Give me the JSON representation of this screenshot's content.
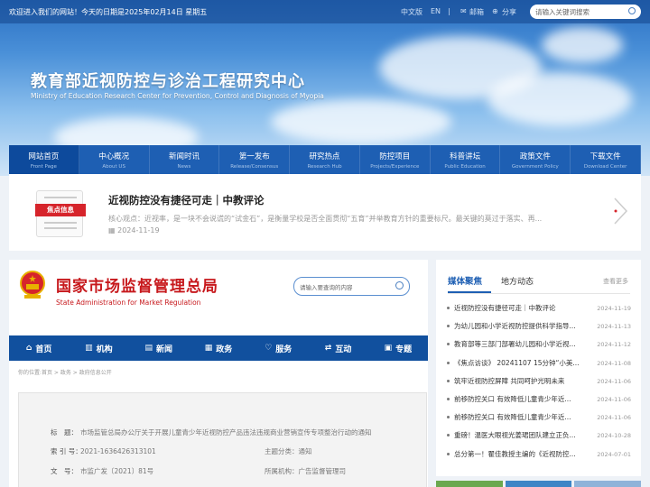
{
  "topbar": {
    "welcome": "欢迎进入我们的网站！今天的日期是2025年02月14日 星期五",
    "lang_cn": "中文版",
    "lang_en": "EN",
    "sep": "|",
    "mail": "邮箱",
    "share": "分享",
    "search_placeholder": "请输入关键词搜索"
  },
  "site": {
    "title": "教育部近视防控与诊治工程研究中心",
    "subtitle": "Ministry of Education Research Center for Prevention, Control and Diagnosis of Myopia"
  },
  "nav": [
    {
      "cn": "网站首页",
      "en": "Front Page"
    },
    {
      "cn": "中心概况",
      "en": "About US"
    },
    {
      "cn": "新闻时讯",
      "en": "News"
    },
    {
      "cn": "第一发布",
      "en": "Release/Consensus"
    },
    {
      "cn": "研究热点",
      "en": "Research Hub"
    },
    {
      "cn": "防控项目",
      "en": "Projects/Experience"
    },
    {
      "cn": "科普讲坛",
      "en": "Public Education"
    },
    {
      "cn": "政策文件",
      "en": "Government Policy"
    },
    {
      "cn": "下载文件",
      "en": "Download Center"
    }
  ],
  "focus": {
    "tag": "焦点信息",
    "headline": "近视防控没有捷径可走｜中教评论",
    "excerpt": "核心观点：近视率，是一块不会说谎的“试金石”，是衡量学校是否全面贯彻“五育”并举教育方针的重要标尺。最关键的莫过于落实、再...",
    "date": "2024-11-19"
  },
  "samr": {
    "name_cn": "国家市场监督管理总局",
    "name_en": "State Administration for Market Regulation",
    "search_placeholder": "请输入要查询的内容",
    "nav": [
      "首页",
      "机构",
      "新闻",
      "政务",
      "服务",
      "互动",
      "专题"
    ],
    "nav_icons": [
      "home-icon",
      "building-icon",
      "news-icon",
      "government-icon",
      "heart-icon",
      "exchange-icon",
      "topic-icon"
    ],
    "breadcrumb": "你的位置:首页 > 政务 > 政府信息公开",
    "doc": {
      "title_label": "标　题：",
      "title_value": "市场监管总局办公厅关于开展儿童青少年近视防控产品违法违规商业营销宣传专项整治行动的通知",
      "index_label": "索 引 号：",
      "index_value": "2021-1636426313101",
      "category_label": "主题分类：",
      "category_value": "通知",
      "number_label": "文　号：",
      "number_value": "市监广发〔2021〕81号",
      "org_label": "所属机构：",
      "org_value": "广告监督管理司"
    }
  },
  "media": {
    "tab_active": "媒体聚焦",
    "tab_other": "地方动态",
    "more": "查看更多",
    "items": [
      {
        "title": "近视防控没有捷径可走｜中教评论",
        "date": "2024-11-19"
      },
      {
        "title": "为幼儿园和小学近视防控提供科学指导...",
        "date": "2024-11-13"
      },
      {
        "title": "教育部等三部门部署幼儿园和小学近视...",
        "date": "2024-11-12"
      },
      {
        "title": "《焦点访谈》 20241107 15分钟“小美...",
        "date": "2024-11-08"
      },
      {
        "title": "筑牢近视防控屏障 共同呵护光明未来",
        "date": "2024-11-06"
      },
      {
        "title": "前移防控关口 有效降低儿童青少年近...",
        "date": "2024-11-06"
      },
      {
        "title": "前移防控关口 有效降低儿童青少年近...",
        "date": "2024-11-06"
      },
      {
        "title": "重磅！温医大眼视光姜珺团队建立正负...",
        "date": "2024-10-28"
      },
      {
        "title": "总分第一！瞿佳教授主编的《近视防控...",
        "date": "2024-07-01"
      }
    ]
  },
  "colors": {
    "primary": "#1e5fb3",
    "samr_red": "#c7191d",
    "tag_red": "#d6242b"
  }
}
